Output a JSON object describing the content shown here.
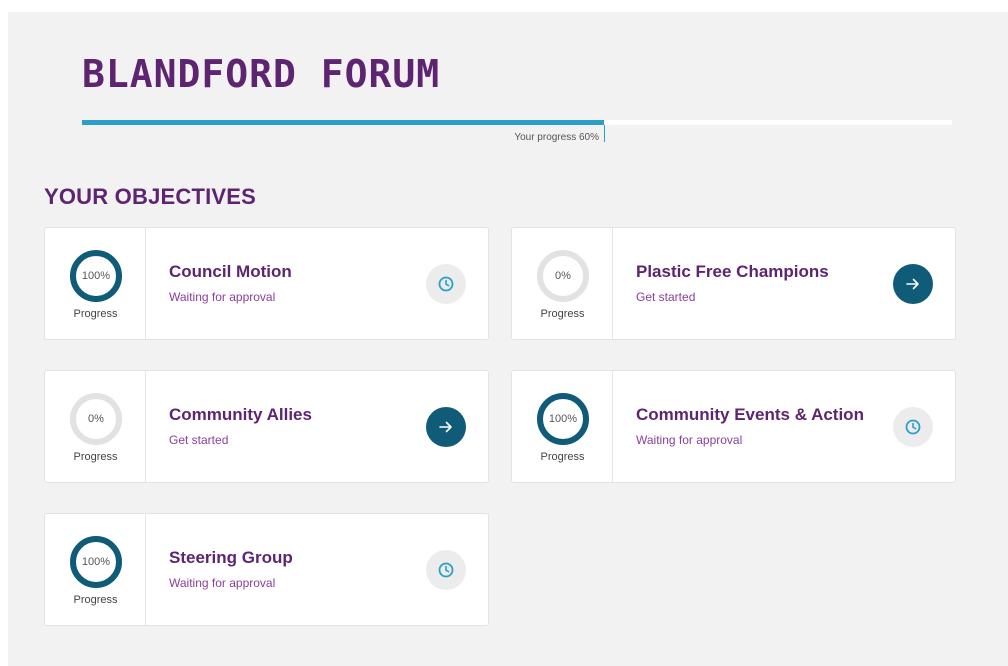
{
  "header": {
    "title": "BLANDFORD FORUM",
    "progress_label": "Your progress 60%",
    "progress_value": 60
  },
  "section_title": "YOUR OBJECTIVES",
  "colors": {
    "brand": "#5e2472",
    "accent": "#2aa0c9",
    "ring_complete": "#0f5b78",
    "ring_empty": "#e2e2e2",
    "action_button": "#0f5b78"
  },
  "cards": [
    {
      "title": "Council Motion",
      "status": "Waiting for approval",
      "percent_label": "100%",
      "percent": 100,
      "progress_label": "Progress",
      "action_icon": "clock-icon"
    },
    {
      "title": "Plastic Free Champions",
      "status": "Get started",
      "percent_label": "0%",
      "percent": 0,
      "progress_label": "Progress",
      "action_icon": "arrow-right-icon"
    },
    {
      "title": "Community Allies",
      "status": "Get started",
      "percent_label": "0%",
      "percent": 0,
      "progress_label": "Progress",
      "action_icon": "arrow-right-icon"
    },
    {
      "title": "Community Events & Action",
      "status": "Waiting for approval",
      "percent_label": "100%",
      "percent": 100,
      "progress_label": "Progress",
      "action_icon": "clock-icon"
    },
    {
      "title": "Steering Group",
      "status": "Waiting for approval",
      "percent_label": "100%",
      "percent": 100,
      "progress_label": "Progress",
      "action_icon": "clock-icon"
    }
  ]
}
